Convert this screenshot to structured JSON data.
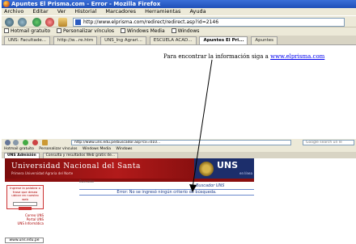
{
  "window1": {
    "title": "Apuntes El Prisma.com - Error - Mozilla Firefox",
    "menu": [
      "Archivo",
      "Editar",
      "Ver",
      "Historial",
      "Marcadores",
      "Herramientas",
      "Ayuda"
    ],
    "url": "http://www.elprisma.com/redirect/redirect.asp?id=2146",
    "bookmarks": [
      "Hotmail gratuito",
      "Personalizar vínculos",
      "Windows Media",
      "Windows"
    ],
    "tabs": [
      "UNS: Facultade...",
      "http://w...re.htm",
      "UNS_Ing Agrari...",
      "ESCUELA ACAD...",
      "Apuntes El Pri...",
      "Apuntes"
    ],
    "active_tab_index": 4,
    "message_text": "Para encontrar la información siga a ",
    "message_link": "www.elprisma.com"
  },
  "window2": {
    "url": "http://www.uns.edu.pe/buscador.asp?cx=010...",
    "search_placeholder": "Google search un le",
    "bookmarks": [
      "Hotmail gratuito",
      "Personalizar vínculos",
      "Windows Media",
      "Windows"
    ],
    "tabs": [
      "UNS Admisión",
      "Consulta y resultados Web gratis de..."
    ],
    "banner_title": "Universidad Nacional del Santa",
    "banner_subtitle": "Primera Universidad Agraria del Norte",
    "uns_logo_text": "UNS",
    "uns_online_text": "en línea",
    "sidebox_text": "Ingrese la palabra o frase que desea ubicar en nuestro web",
    "sidelinks": [
      "Correo UNS",
      "Portal UNS",
      "UNS Informática"
    ],
    "crumb": "Buscador",
    "buscador_label": "Buscador UNS",
    "error_text": "Error: No se ingresó ningún criterio de búsqueda.",
    "web_address": "www.uns.edu.pe"
  }
}
